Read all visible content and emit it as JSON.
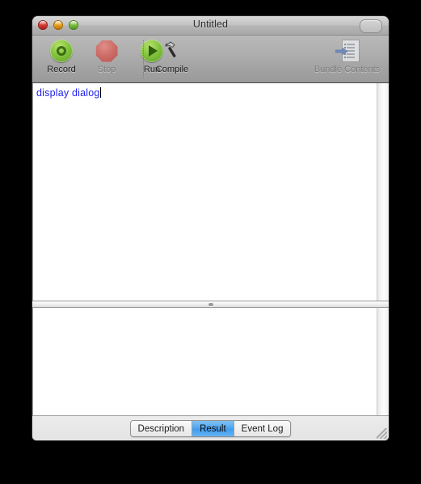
{
  "window": {
    "title": "Untitled",
    "controls": {
      "close_label": "close",
      "minimize_label": "minimize",
      "zoom_label": "zoom"
    },
    "toolbar_toggle_name": "toolbar-toggle"
  },
  "toolbar": {
    "items": [
      {
        "label": "Record",
        "icon": "record-icon",
        "enabled": true,
        "name": "toolbar-button-record"
      },
      {
        "label": "Stop",
        "icon": "stop-icon",
        "enabled": false,
        "name": "toolbar-button-stop"
      },
      {
        "label": "Run",
        "icon": "run-icon",
        "enabled": true,
        "name": "toolbar-button-run"
      },
      {
        "label": "Compile",
        "icon": "hammer-icon",
        "enabled": true,
        "name": "toolbar-button-compile"
      },
      {
        "label": "Bundle Contents",
        "icon": "bundle-contents-icon",
        "enabled": false,
        "name": "toolbar-button-bundle-contents"
      }
    ]
  },
  "editor": {
    "script_text": "display dialog",
    "text_color": "#2222ee",
    "caret_visible": true
  },
  "result": {
    "content": ""
  },
  "footer": {
    "tabs": [
      {
        "label": "Description",
        "selected": false
      },
      {
        "label": "Result",
        "selected": true
      },
      {
        "label": "Event Log",
        "selected": false
      }
    ],
    "selected_tab": "Result",
    "accent_color": "#3e9aee"
  }
}
